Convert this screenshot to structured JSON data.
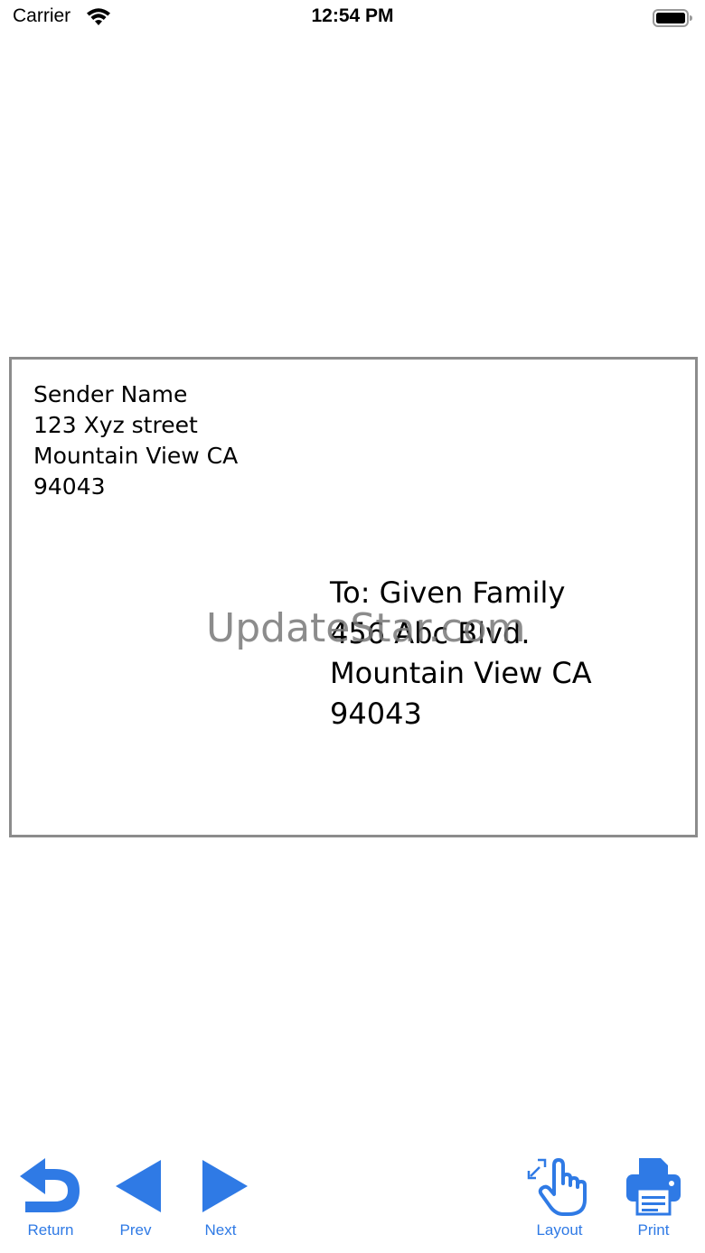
{
  "status_bar": {
    "carrier": "Carrier",
    "time": "12:54 PM"
  },
  "envelope": {
    "sender": {
      "name": "Sender Name",
      "street": "123 Xyz street",
      "city": "Mountain View CA",
      "zip": "94043"
    },
    "recipient": {
      "name": "To: Given Family",
      "street": "456 Abc Blvd.",
      "city": "Mountain View CA",
      "zip": "94043"
    },
    "watermark": "UpdateStar.com"
  },
  "toolbar": {
    "return_label": "Return",
    "prev_label": "Prev",
    "next_label": "Next",
    "layout_label": "Layout",
    "print_label": "Print"
  },
  "colors": {
    "accent": "#2f7ae5",
    "border": "#8c8c8c"
  },
  "icons": {
    "return": "return-arrow-icon",
    "prev": "triangle-left-icon",
    "next": "triangle-right-icon",
    "layout": "hand-pointer-icon",
    "print": "printer-icon"
  }
}
